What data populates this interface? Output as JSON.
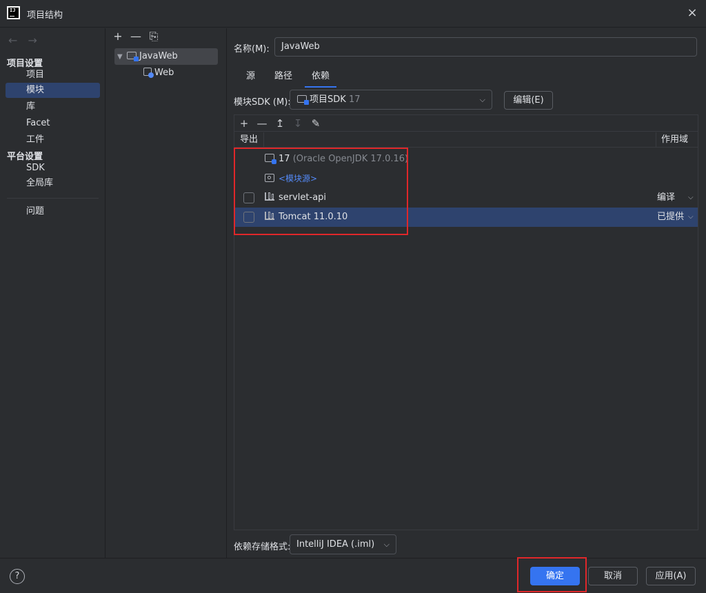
{
  "window": {
    "title": "项目结构",
    "close_icon": "×"
  },
  "nav": {
    "back_icon": "←",
    "forward_icon": "→",
    "project_settings_heading": "项目设置",
    "project_items": [
      "项目",
      "模块",
      "库",
      "Facet",
      "工件"
    ],
    "platform_settings_heading": "平台设置",
    "platform_items": [
      "SDK",
      "全局库"
    ],
    "problems_item": "问题",
    "selected": "模块"
  },
  "tree": {
    "toolbar": {
      "add_icon": "+",
      "remove_icon": "—",
      "copy_icon": "⎘"
    },
    "module": {
      "label": "JavaWeb",
      "expander": "▼"
    },
    "facet": {
      "label": "Web"
    }
  },
  "main": {
    "name_label": "名称(M):",
    "name_value": "JavaWeb",
    "tabs": [
      "源",
      "路径",
      "依赖"
    ],
    "active_tab": "依赖",
    "sdk_label": "模块SDK (M):",
    "sdk_value": "项目SDK",
    "sdk_version": "17",
    "sdk_caret": "⌵",
    "edit_button": "编辑(E)",
    "dep_toolbar": {
      "add_icon": "+",
      "remove_icon": "—",
      "move_up_icon": "↥",
      "move_down_icon": "↧",
      "edit_icon": "✎"
    },
    "columns": {
      "export": "导出",
      "scope": "作用域"
    },
    "dependencies": [
      {
        "name": "17",
        "detail": "(Oracle OpenJDK 17.0.16)",
        "type": "sdk"
      },
      {
        "name": "<模块源>",
        "type": "source"
      },
      {
        "name": "servlet-api",
        "scope": "编译",
        "type": "library",
        "exported": false
      },
      {
        "name": "Tomcat 11.0.10",
        "scope": "已提供",
        "type": "library",
        "exported": false,
        "selected": true
      }
    ],
    "storage_label": "依赖存储格式:",
    "storage_value": "IntelliJ IDEA (.iml)",
    "storage_caret": "⌵"
  },
  "footer": {
    "help_icon": "?",
    "ok": "确定",
    "cancel": "取消",
    "apply": "应用(A)"
  },
  "colors": {
    "accent": "#3574f0",
    "selection": "#2e436e",
    "highlight": "#e0272a"
  }
}
